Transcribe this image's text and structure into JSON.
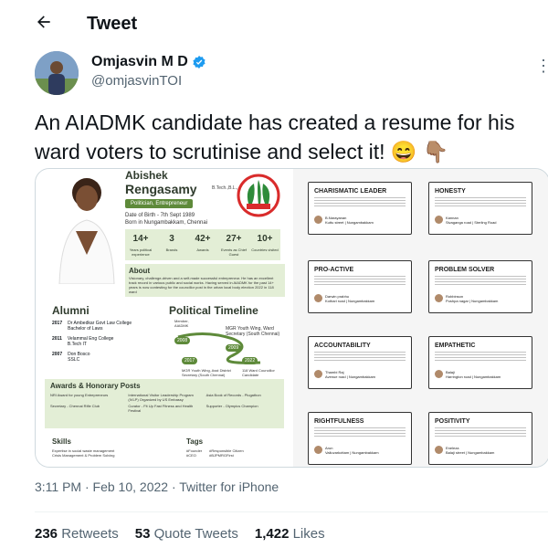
{
  "header": {
    "title": "Tweet",
    "back_icon": "arrow-left-icon"
  },
  "author": {
    "name": "Omjasvin M D",
    "handle": "@omjasvinTOI",
    "verified": true
  },
  "tweet": {
    "text": "An AIADMK candidate has created a resume for his ward voters to scrutinise and select it! 😄 👇🏽"
  },
  "media": {
    "left": {
      "name_line1": "Abishek",
      "name_line2": "Rengasamy",
      "degree": "B.Tech.,B.L.,",
      "role": "Politician, Entrepreneur",
      "dob": "Date of Birth - 7th Sept 1989",
      "born": "Born in Nungambakkam, Chennai",
      "stats": [
        {
          "value": "14+",
          "label": "Years political experience"
        },
        {
          "value": "3",
          "label": "Brands"
        },
        {
          "value": "42+",
          "label": "Awards"
        },
        {
          "value": "27+",
          "label": "Events as Chief Guest"
        },
        {
          "value": "10+",
          "label": "Countries visited"
        }
      ],
      "about_title": "About",
      "about_text": "Visionary, challenge-driven and a self-made successful entrepreneur. He has an excellent track record in various public and social works. Having served in AIADMK for the past 14+ years is now contesting for the councillor post in the urban local body election 2022 in 118 ward",
      "alumni_title": "Alumni",
      "alumni": [
        {
          "year": "2017",
          "school": "Dr Ambedkar Govt Law College",
          "degree": "Bachelor of Laws"
        },
        {
          "year": "2011",
          "school": "Velammal Eng College",
          "degree": "B.Tech IT"
        },
        {
          "year": "2007",
          "school": "Don Bosco",
          "degree": "SSLC"
        }
      ],
      "timeline_title": "Political Timeline",
      "timeline": [
        {
          "year": "2008",
          "label": "Member, AIADMK"
        },
        {
          "year": "2009",
          "label": "MGR Youth Wing, Ward Secretary (South Chennai)"
        },
        {
          "year": "2017",
          "label": "MGR Youth Wing, Asst District Secretary (South Chennai)"
        },
        {
          "year": "2022",
          "label": "118 Ward Councillor Candidate"
        }
      ],
      "awards_title": "Awards & Honorary Posts",
      "awards": [
        "NRI Award for young Entrepreneurs",
        "International Visitor Leadership Program (IVLP) Organized by US Embassy",
        "Asia Book of Records - Plugathon",
        "Secretary - Chennai Rifle Club",
        "Curator - Fit Up Fast Fitness and Health Festival",
        "Supporter - Olympics Champion"
      ],
      "skills_title": "Skills",
      "skills": [
        "Expertise in social waste management",
        "Crisis Management & Problem Solving"
      ],
      "tags_title": "Tags",
      "tags": [
        "#Founder",
        "#Responsible Citizen",
        "#CEO",
        "#BJPMRGFirst"
      ]
    },
    "right": {
      "cards": [
        {
          "title": "CHARISMATIC LEADER",
          "name": "B.Narayanan",
          "place": "Kuttu street | Nungambakkam"
        },
        {
          "title": "HONESTY",
          "name": "Kannan",
          "place": "Sivaganga road | Sterling Road"
        },
        {
          "title": "PRO-ACTIVE",
          "name": "Darwin prabhu",
          "place": "Kothari road | Nungambakkam"
        },
        {
          "title": "PROBLEM SOLVER",
          "name": "Robbinson",
          "place": "Pushpa nagar | Nungambakkam"
        },
        {
          "title": "ACCOUNTABILITY",
          "name": "Thambi Raj",
          "place": "Avenue road | Nungambakkam"
        },
        {
          "title": "EMPATHETIC",
          "name": "Balaji",
          "place": "Harrington road | Nungambakkam"
        },
        {
          "title": "RIGHTFULNESS",
          "name": "Arun",
          "place": "Valluvarkottam | Nungambakkam"
        },
        {
          "title": "POSITIVITY",
          "name": "Eneleza",
          "place": "Balaji street | Nungambakkam"
        }
      ]
    }
  },
  "timestamp": "3:11 PM · Feb 10, 2022 · Twitter for iPhone",
  "stats": {
    "retweets": {
      "value": "236",
      "label": "Retweets"
    },
    "quotes": {
      "value": "53",
      "label": "Quote Tweets"
    },
    "likes": {
      "value": "1,422",
      "label": "Likes"
    }
  },
  "colors": {
    "brand_green": "#5e8a3a",
    "verified_blue": "#1d9bf0",
    "muted": "#536471"
  }
}
